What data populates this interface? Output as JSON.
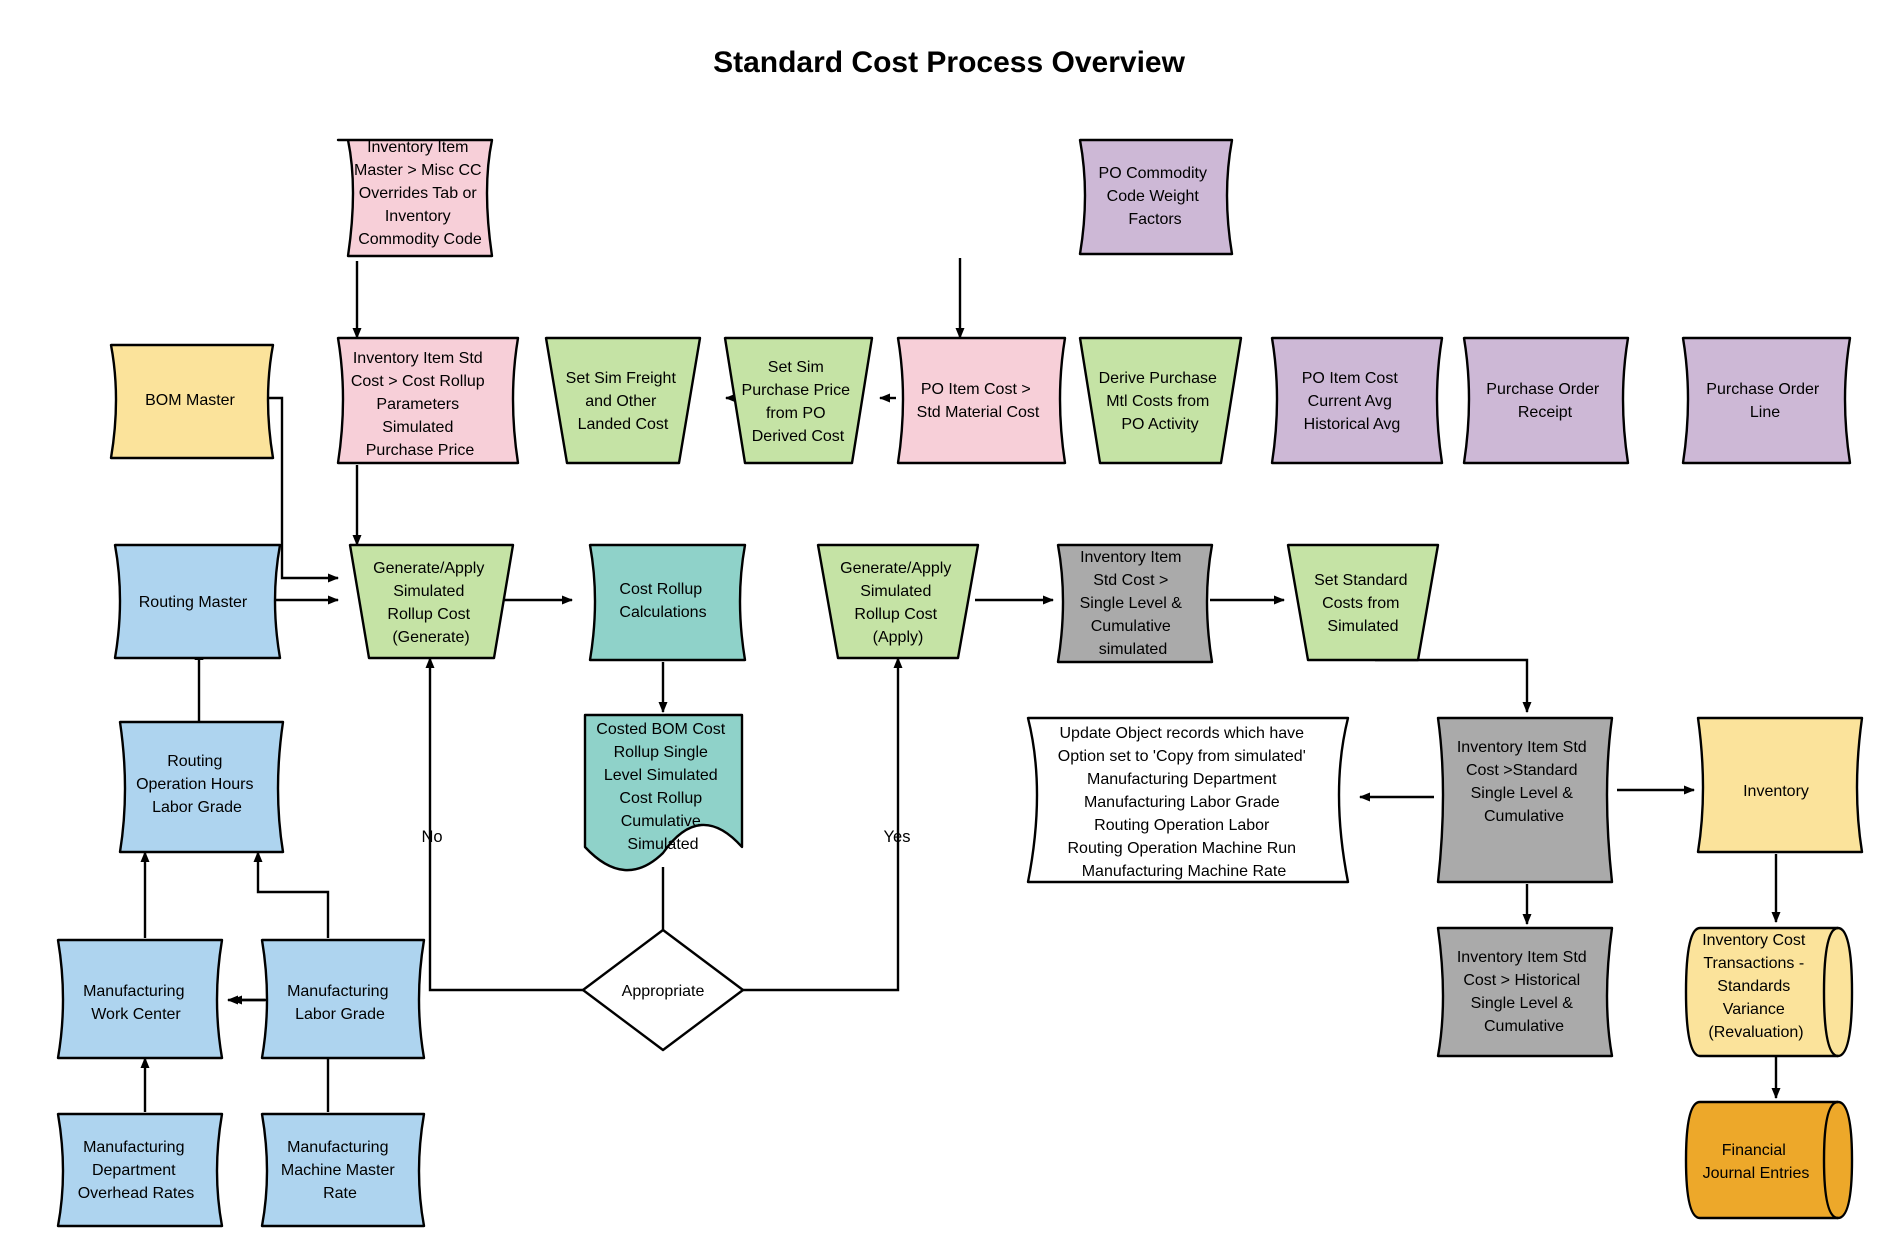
{
  "title": "Standard Cost Process Overview",
  "colors": {
    "pink": "#f7cfd8",
    "purple": "#cdb8d6",
    "green": "#c5e3a5",
    "yellow": "#fbe39b",
    "blue": "#aed4ef",
    "teal": "#8fd2c9",
    "gray": "#aaaaaa",
    "orange": "#eda82a",
    "white": "#ffffff",
    "stroke": "#000000"
  },
  "nodes": {
    "inv_item_master": {
      "label": "Inventory Item Master > Misc CC Overrides Tab or Inventory Commodity Code",
      "lines": [
        "Inventory Item",
        "Master > Misc CC",
        "Overrides Tab or",
        "Inventory",
        "Commodity Code"
      ],
      "shape": "data-curved",
      "color": "pink"
    },
    "po_commodity": {
      "label": "PO Commodity Code Weight Factors",
      "lines": [
        "PO Commodity",
        "Code Weight",
        "Factors"
      ],
      "shape": "data-curved",
      "color": "purple"
    },
    "bom_master": {
      "label": "BOM Master",
      "lines": [
        "BOM Master"
      ],
      "shape": "data-curved",
      "color": "yellow"
    },
    "inv_std_cost_params": {
      "label": "Inventory Item Std Cost > Cost Rollup Parameters Simulated Purchase Price",
      "lines": [
        "Inventory Item Std",
        "Cost > Cost Rollup",
        "Parameters",
        "Simulated",
        "Purchase Price"
      ],
      "shape": "data-curved",
      "color": "pink"
    },
    "set_sim_freight": {
      "label": "Set Sim Freight and Other Landed Cost",
      "lines": [
        "Set Sim Freight",
        "and Other",
        "Landed Cost"
      ],
      "shape": "trapezoid",
      "color": "green"
    },
    "set_sim_purch_price": {
      "label": "Set Sim Purchase Price from PO Derived Cost",
      "lines": [
        "Set Sim",
        "Purchase Price",
        "from PO",
        "Derived Cost"
      ],
      "shape": "trapezoid",
      "color": "green"
    },
    "po_item_cost_std": {
      "label": "PO Item Cost > Std Material Cost",
      "lines": [
        "PO Item Cost >",
        "Std Material Cost"
      ],
      "shape": "data-curved",
      "color": "pink"
    },
    "derive_purchase": {
      "label": "Derive Purchase Mtl Costs from PO Activity",
      "lines": [
        "Derive Purchase",
        "Mtl Costs from",
        "PO Activity"
      ],
      "shape": "trapezoid",
      "color": "green"
    },
    "po_item_cost_avg": {
      "label": "PO Item Cost Current Avg Historical Avg",
      "lines": [
        "PO Item Cost",
        "Current Avg",
        "Historical Avg"
      ],
      "shape": "data-curved",
      "color": "purple"
    },
    "po_receipt": {
      "label": "Purchase Order Receipt",
      "lines": [
        "Purchase Order",
        "Receipt"
      ],
      "shape": "data-curved",
      "color": "purple"
    },
    "po_line": {
      "label": "Purchase Order Line",
      "lines": [
        "Purchase Order",
        "Line"
      ],
      "shape": "data-curved",
      "color": "purple"
    },
    "routing_master": {
      "label": "Routing Master",
      "lines": [
        "Routing Master"
      ],
      "shape": "data-curved",
      "color": "blue"
    },
    "gen_apply_generate": {
      "label": "Generate/Apply Simulated Rollup Cost (Generate)",
      "lines": [
        "Generate/Apply",
        "Simulated",
        "Rollup Cost",
        "(Generate)"
      ],
      "shape": "trapezoid",
      "color": "green"
    },
    "cost_rollup_calc": {
      "label": "Cost Rollup Calculations",
      "lines": [
        "Cost Rollup",
        "Calculations"
      ],
      "shape": "data-curved",
      "color": "teal"
    },
    "gen_apply_apply": {
      "label": "Generate/Apply Simulated Rollup Cost (Apply)",
      "lines": [
        "Generate/Apply",
        "Simulated",
        "Rollup Cost",
        "(Apply)"
      ],
      "shape": "trapezoid",
      "color": "green"
    },
    "inv_std_cost_sim": {
      "label": "Inventory Item Std Cost > Single Level & Cumulative simulated",
      "lines": [
        "Inventory Item",
        "Std Cost >",
        "Single Level &",
        "Cumulative",
        "simulated"
      ],
      "shape": "data-curved",
      "color": "gray"
    },
    "set_standard_costs": {
      "label": "Set Standard Costs from Simulated",
      "lines": [
        "Set Standard",
        "Costs from",
        "Simulated"
      ],
      "shape": "trapezoid",
      "color": "green"
    },
    "costed_bom": {
      "label": "Costed BOM Cost Rollup Single Level Simulated Cost Rollup Cumulative Simulated",
      "lines": [
        "Costed BOM Cost",
        "Rollup Single",
        "Level Simulated",
        "Cost Rollup",
        "Cumulative",
        "Simulated"
      ],
      "shape": "document",
      "color": "teal"
    },
    "appropriate": {
      "label": "Appropriate",
      "lines": [
        "Appropriate"
      ],
      "shape": "diamond",
      "color": "white"
    },
    "update_note": {
      "label": "Update Object records which have Option set to 'Copy from simulated' Manufacturing Department Manufacturing Labor Grade Routing Operation Labor Routing Operation Machine Run Manufacturing Machine Rate",
      "lines": [
        "Update Object records which have",
        "Option set to 'Copy from simulated'",
        "Manufacturing Department",
        "Manufacturing Labor Grade",
        "Routing Operation Labor",
        "Routing Operation Machine Run",
        "Manufacturing Machine Rate"
      ],
      "shape": "data-curved",
      "color": "white"
    },
    "inv_std_cost_standard": {
      "label": "Inventory Item Std Cost >Standard Single Level & Cumulative",
      "lines": [
        "Inventory Item Std",
        "Cost >Standard",
        "Single Level &",
        "Cumulative"
      ],
      "shape": "data-curved",
      "color": "gray"
    },
    "inventory": {
      "label": "Inventory",
      "lines": [
        "Inventory"
      ],
      "shape": "data-curved",
      "color": "yellow"
    },
    "inv_std_cost_hist": {
      "label": "Inventory Item Std Cost > Historical Single Level & Cumulative",
      "lines": [
        "Inventory Item Std",
        "Cost > Historical",
        "Single Level &",
        "Cumulative"
      ],
      "shape": "data-curved",
      "color": "gray"
    },
    "inv_cost_trans": {
      "label": "Inventory Cost Transactions - Standards Variance (Revaluation)",
      "lines": [
        "Inventory Cost",
        "Transactions -",
        "Standards",
        "Variance",
        "(Revaluation)"
      ],
      "shape": "cylinder",
      "color": "yellow"
    },
    "financial_journal": {
      "label": "Financial Journal Entries",
      "lines": [
        "Financial",
        "Journal Entries"
      ],
      "shape": "cylinder",
      "color": "orange"
    },
    "routing_op_hours": {
      "label": "Routing Operation Hours Labor Grade",
      "lines": [
        "Routing",
        "Operation Hours",
        "Labor Grade"
      ],
      "shape": "data-curved",
      "color": "blue"
    },
    "mfg_work_center": {
      "label": "Manufacturing Work Center",
      "lines": [
        "Manufacturing",
        "Work Center"
      ],
      "shape": "data-curved",
      "color": "blue"
    },
    "mfg_labor_grade": {
      "label": "Manufacturing Labor Grade",
      "lines": [
        "Manufacturing",
        "Labor Grade"
      ],
      "shape": "data-curved",
      "color": "blue"
    },
    "mfg_dept_overhead": {
      "label": "Manufacturing Department Overhead Rates",
      "lines": [
        "Manufacturing",
        "Department",
        "Overhead Rates"
      ],
      "shape": "data-curved",
      "color": "blue"
    },
    "mfg_machine_master": {
      "label": "Manufacturing Machine Master Rate",
      "lines": [
        "Manufacturing",
        "Machine Master",
        "Rate"
      ],
      "shape": "data-curved",
      "color": "blue"
    }
  },
  "edge_labels": {
    "no": "No",
    "yes": "Yes"
  }
}
